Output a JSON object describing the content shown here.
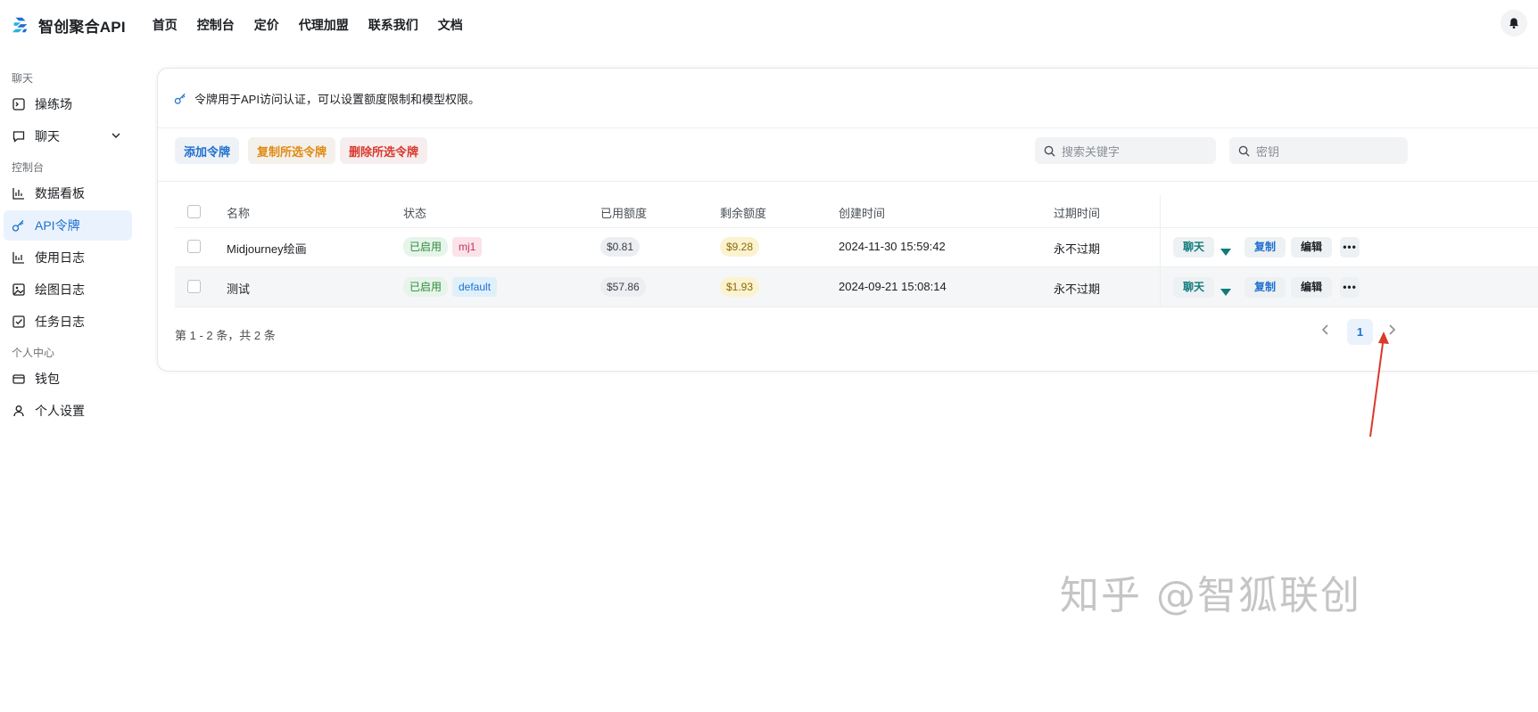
{
  "app": {
    "title": "智创聚合API"
  },
  "nav": [
    "首页",
    "控制台",
    "定价",
    "代理加盟",
    "联系我们",
    "文档"
  ],
  "sidebar": {
    "groups": [
      {
        "label": "聊天",
        "items": [
          {
            "label": "操练场",
            "icon": "playground-icon"
          },
          {
            "label": "聊天",
            "icon": "chat-icon",
            "expandable": true
          }
        ]
      },
      {
        "label": "控制台",
        "items": [
          {
            "label": "数据看板",
            "icon": "chart-icon"
          },
          {
            "label": "API令牌",
            "icon": "key-icon",
            "active": true
          },
          {
            "label": "使用日志",
            "icon": "log-icon"
          },
          {
            "label": "绘图日志",
            "icon": "image-icon"
          },
          {
            "label": "任务日志",
            "icon": "task-icon"
          }
        ]
      },
      {
        "label": "个人中心",
        "items": [
          {
            "label": "钱包",
            "icon": "wallet-icon"
          },
          {
            "label": "个人设置",
            "icon": "user-icon"
          }
        ]
      }
    ]
  },
  "page": {
    "info": "令牌用于API访问认证，可以设置额度限制和模型权限。",
    "buttons": {
      "add": "添加令牌",
      "copy_selected": "复制所选令牌",
      "delete_selected": "删除所选令牌"
    },
    "search": {
      "keyword_placeholder": "搜索关键字",
      "key_placeholder": "密钥"
    }
  },
  "table": {
    "headers": [
      "名称",
      "状态",
      "已用额度",
      "剩余额度",
      "创建时间",
      "过期时间"
    ],
    "rows": [
      {
        "name": "Midjourney绘画",
        "status": "已启用",
        "group": "mj1",
        "used": "$0.81",
        "remaining": "$9.28",
        "created": "2024-11-30 15:59:42",
        "expires": "永不过期"
      },
      {
        "name": "测试",
        "status": "已启用",
        "group": "default",
        "used": "$57.86",
        "remaining": "$1.93",
        "created": "2024-09-21 15:08:14",
        "expires": "永不过期"
      }
    ],
    "actions": {
      "chat": "聊天",
      "copy": "复制",
      "edit": "编辑",
      "more": "•••"
    }
  },
  "pagination": {
    "summary": "第 1 - 2 条，共 2 条",
    "current": "1"
  },
  "watermark": "知乎 @智狐联创",
  "colors": {
    "primary": "#1f6fd1",
    "warning": "#e08a12",
    "danger": "#d9382d",
    "teal": "#0f7a7a",
    "annotation_arrow": "#d93a2b"
  }
}
